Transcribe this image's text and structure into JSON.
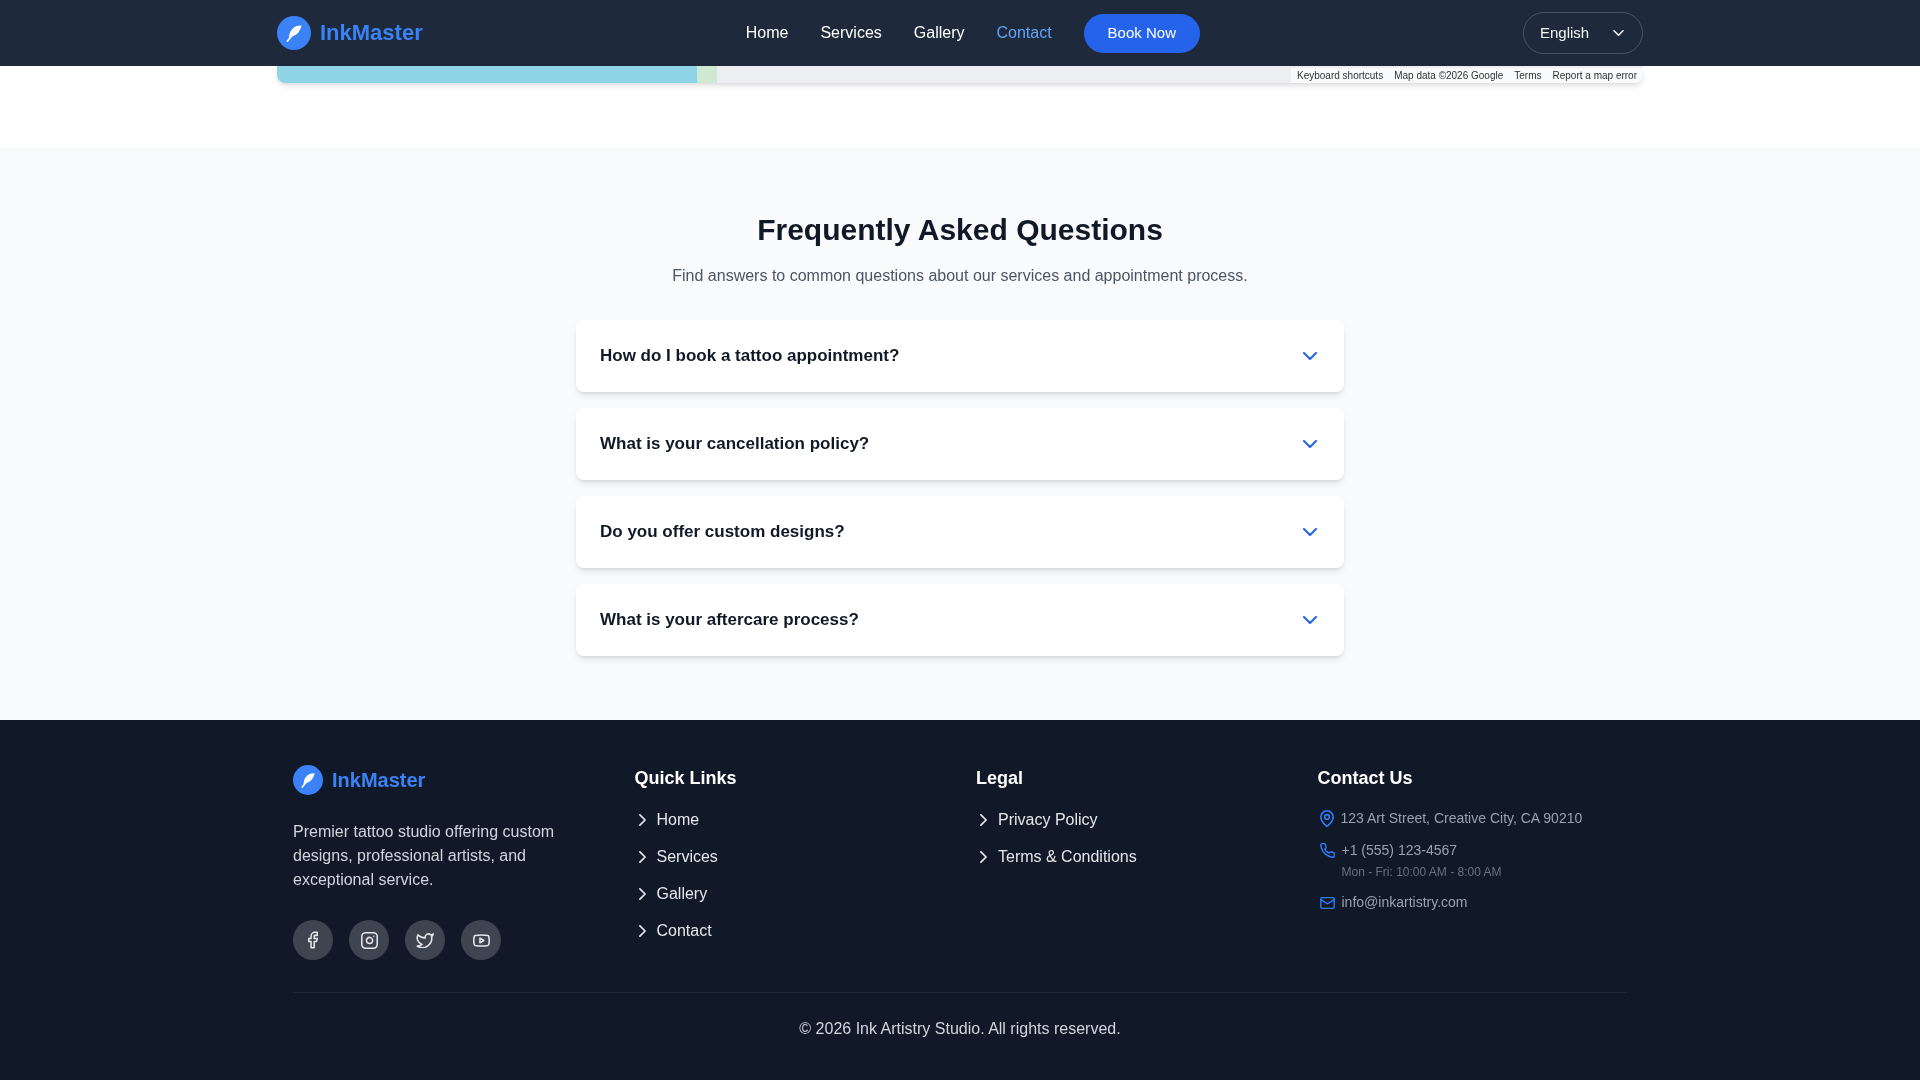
{
  "header": {
    "logo": "InkMaster",
    "nav": [
      {
        "label": "Home",
        "selected": false
      },
      {
        "label": "Services",
        "selected": false
      },
      {
        "label": "Gallery",
        "selected": false
      },
      {
        "label": "Contact",
        "selected": true
      }
    ],
    "cta": "Book Now",
    "language": "English"
  },
  "map": {
    "attribution": [
      "Keyboard shortcuts",
      "Map data ©2026 Google",
      "Terms",
      "Report a map error"
    ]
  },
  "faq": {
    "title": "Frequently Asked Questions",
    "subtitle": "Find answers to common questions about our services and appointment process.",
    "items": [
      {
        "question": "How do I book a tattoo appointment?",
        "expanded": false
      },
      {
        "question": "What is your cancellation policy?",
        "expanded": false
      },
      {
        "question": "Do you offer custom designs?",
        "expanded": false
      },
      {
        "question": "What is your aftercare process?",
        "expanded": false
      }
    ]
  },
  "footer": {
    "brand": {
      "logo": "InkMaster",
      "description": "Premier tattoo studio offering custom designs, professional artists, and exceptional service."
    },
    "quick_links": {
      "title": "Quick Links",
      "links": [
        "Home",
        "Services",
        "Gallery",
        "Contact"
      ]
    },
    "legal": {
      "title": "Legal",
      "links": [
        "Privacy Policy",
        "Terms & Conditions"
      ]
    },
    "contact": {
      "title": "Contact Us",
      "items": [
        {
          "kind": "address",
          "text": "123 Art Street, Creative City, CA 90210"
        },
        {
          "kind": "phone",
          "text": "+1 (555) 123-4567",
          "note": "Mon - Fri: 10:00 AM - 8:00 AM"
        },
        {
          "kind": "email",
          "text": "info@inkartistry.com"
        }
      ]
    },
    "copyright": "© 2026 Ink Artistry Studio. All rights reserved."
  }
}
